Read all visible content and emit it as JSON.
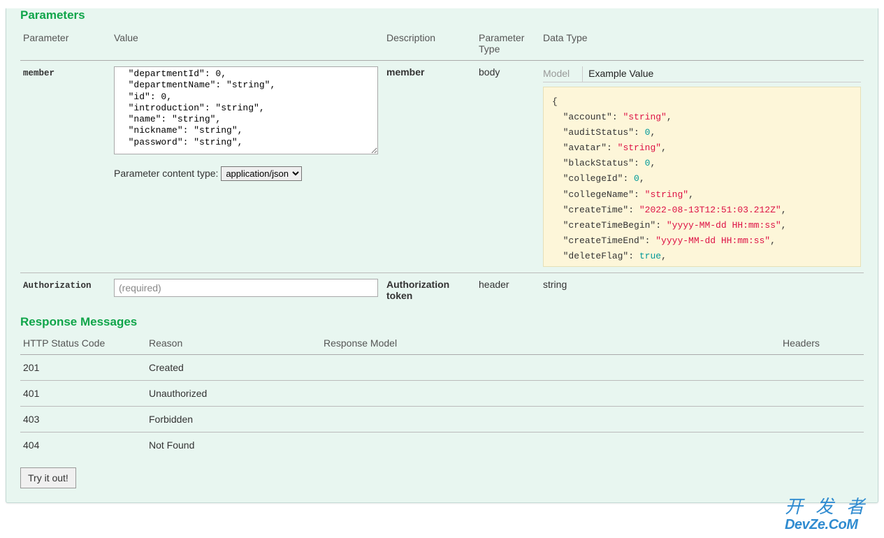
{
  "sections": {
    "parameters_title": "Parameters",
    "responses_title": "Response Messages"
  },
  "param_headers": {
    "parameter": "Parameter",
    "value": "Value",
    "description": "Description",
    "ptype": "Parameter Type",
    "dtype": "Data Type"
  },
  "params": [
    {
      "name": "member",
      "body_text": "  \"departmentId\": 0,\n  \"departmentName\": \"string\",\n  \"id\": 0,\n  \"introduction\": \"string\",\n  \"name\": \"string\",\n  \"nickname\": \"string\",\n  \"password\": \"string\",",
      "content_type_label": "Parameter content type:",
      "content_type_option": "application/json",
      "desc": "member",
      "ptype": "body",
      "tabs": {
        "model": "Model",
        "example": "Example Value"
      },
      "example_json": {
        "account": "string",
        "auditStatus": 0,
        "avatar": "string",
        "blackStatus": 0,
        "collegeId": 0,
        "collegeName": "string",
        "createTime": "2022-08-13T12:51:03.212Z",
        "createTimeBegin": "yyyy-MM-dd HH:mm:ss",
        "createTimeEnd": "yyyy-MM-dd HH:mm:ss",
        "deleteFlag": true
      }
    },
    {
      "name": "Authorization",
      "placeholder": "(required)",
      "desc": "Authorization token",
      "ptype": "header",
      "dtype": "string"
    }
  ],
  "resp_headers": {
    "code": "HTTP Status Code",
    "reason": "Reason",
    "model": "Response Model",
    "headers": "Headers"
  },
  "responses": [
    {
      "code": "201",
      "reason": "Created"
    },
    {
      "code": "401",
      "reason": "Unauthorized"
    },
    {
      "code": "403",
      "reason": "Forbidden"
    },
    {
      "code": "404",
      "reason": "Not Found"
    }
  ],
  "tryout_label": "Try it out!",
  "watermark": {
    "line1": "开发者",
    "line2": "DevZe.CoM"
  }
}
